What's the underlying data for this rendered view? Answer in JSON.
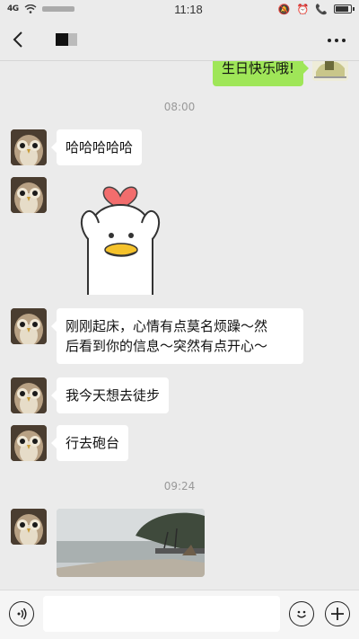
{
  "status": {
    "signal_label": "4G",
    "time": "11:18",
    "battery_level": 0.9,
    "icons": [
      "signal-icon",
      "wifi-icon",
      "mute-icon",
      "alarm-icon",
      "call-icon",
      "battery-icon"
    ]
  },
  "header": {
    "back_icon": "back-arrow-icon",
    "more_icon": "more-options-icon"
  },
  "top_message": {
    "text": "生日快乐哦!"
  },
  "timestamps": [
    "08:00",
    "09:24"
  ],
  "messages": [
    {
      "text": "哈哈哈哈哈"
    },
    {
      "text": "刚刚起床，心情有点莫名烦躁～然\n后看到你的信息～突然有点开心～"
    },
    {
      "text": "我今天想去徒步"
    },
    {
      "text": "行去砲台"
    }
  ],
  "input": {
    "placeholder": ""
  },
  "colors": {
    "self_bubble": "#9fe658",
    "other_bubble": "#ffffff",
    "background": "#ebebeb"
  }
}
